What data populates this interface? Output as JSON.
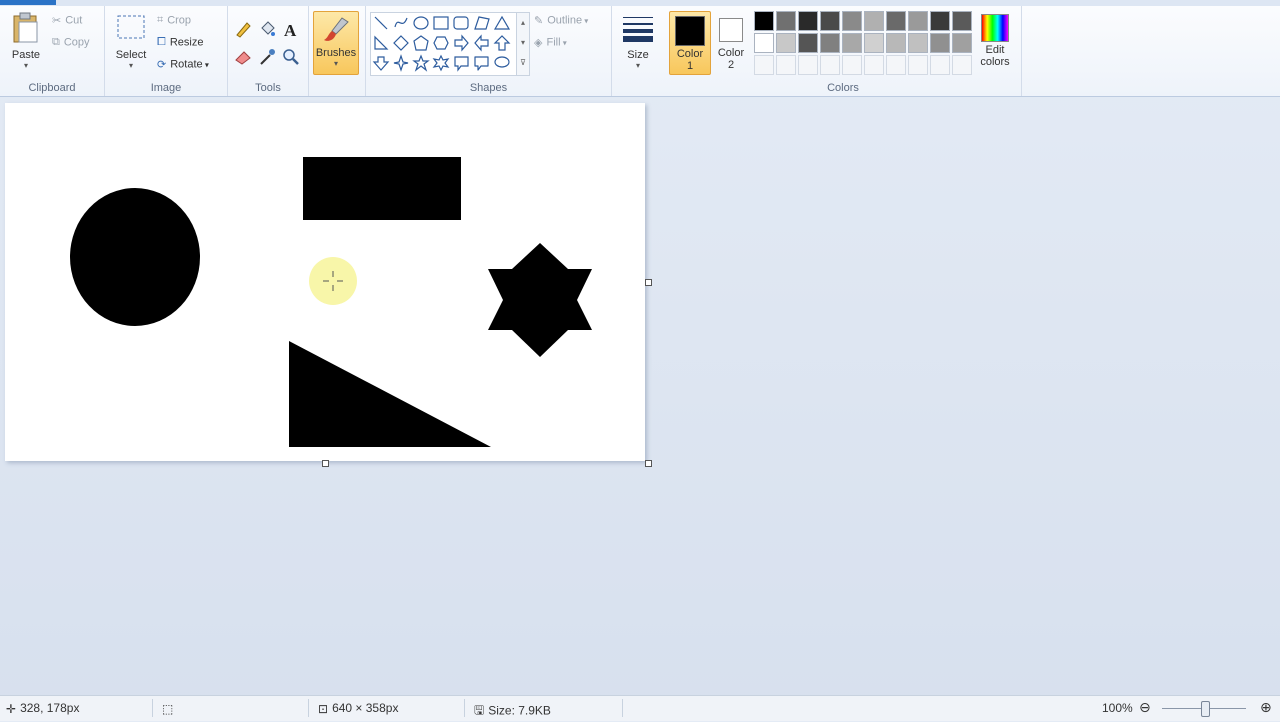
{
  "ribbon": {
    "clipboard": {
      "label": "Clipboard",
      "paste": "Paste",
      "cut": "Cut",
      "copy": "Copy"
    },
    "image": {
      "label": "Image",
      "select": "Select",
      "crop": "Crop",
      "resize": "Resize",
      "rotate": "Rotate"
    },
    "tools": {
      "label": "Tools"
    },
    "brushes": {
      "label": "Brushes"
    },
    "shapes": {
      "label": "Shapes",
      "outline": "Outline",
      "fill": "Fill"
    },
    "size": {
      "label": "Size"
    },
    "colors": {
      "label": "Colors",
      "color1_line1": "Color",
      "color1_line2": "1",
      "color1_value": "#000000",
      "color2_line1": "Color",
      "color2_line2": "2",
      "color2_value": "#ffffff",
      "edit_line1": "Edit",
      "edit_line2": "colors",
      "palette_row1": [
        "#000000",
        "#707070",
        "#2a2a2a",
        "#4a4a4a",
        "#8a8a8a",
        "#b0b0b0",
        "#6a6a6a",
        "#9a9a9a",
        "#3a3a3a",
        "#5a5a5a"
      ],
      "palette_row2": [
        "#ffffff",
        "#c8c8c8",
        "#555555",
        "#808080",
        "#a8a8a8",
        "#d0d0d0",
        "#b8b8b8",
        "#c0c0c0",
        "#909090",
        "#a0a0a0"
      ]
    }
  },
  "status": {
    "cursor_pos": "328, 178px",
    "canvas_size": "640 × 358px",
    "file_size": "Size: 7.9KB",
    "zoom": "100%"
  }
}
